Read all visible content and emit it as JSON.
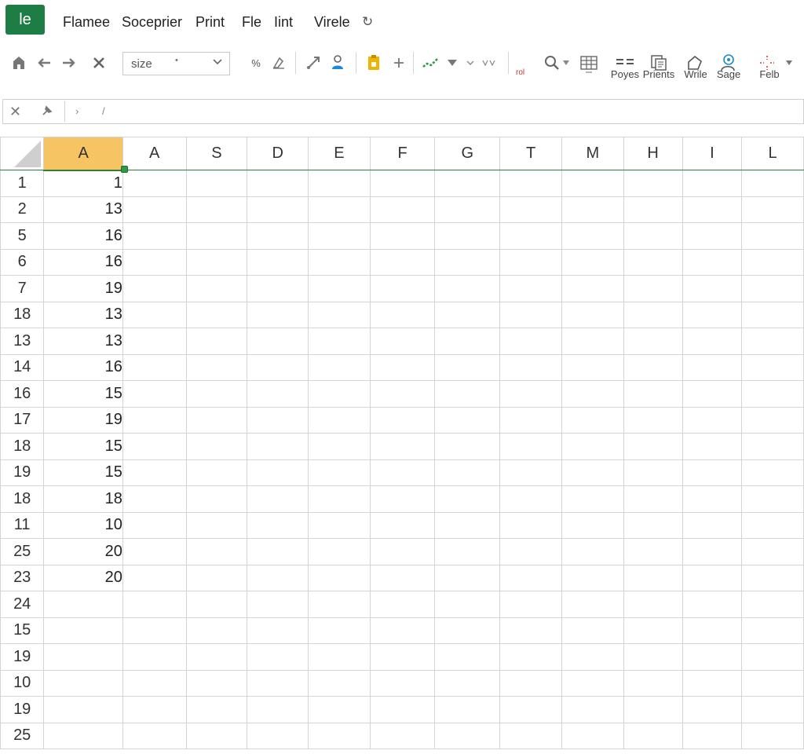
{
  "menubar": {
    "logo_text": "le",
    "items": [
      "Flamee",
      "Soceprier",
      "Print",
      "Fle",
      "Iint",
      "Virele"
    ],
    "extra_glyph": "↻"
  },
  "toolbar": {
    "size_field_value": "size",
    "size_field_dot": "•",
    "percent_label": "%",
    "tiny_red_label": "rol",
    "labeled_buttons": [
      "Poyes",
      "Prients",
      "Wrile",
      "Sage",
      "Felb"
    ],
    "colors": {
      "brand": "#1e7d45",
      "selected_header": "#f7c463",
      "selection_border": "#2e7d32",
      "accent_yellow": "#f0b400",
      "accent_green": "#2e9a44",
      "accent_blue": "#1c8ad6"
    },
    "icons": [
      "home-icon",
      "back-arrow-icon",
      "forward-arrow-icon",
      "close-icon",
      "chevron-down-icon",
      "percent-icon",
      "clear-format-icon",
      "link-icon",
      "user-icon",
      "clipboard-icon",
      "plus-icon",
      "sparkline-icon",
      "triangle-down-icon",
      "search-icon",
      "table-icon",
      "list-icon",
      "copy-icon",
      "home-outline-icon",
      "share-icon",
      "sparkle-icon"
    ]
  },
  "formula_bar": {
    "cancel_glyph": "✕",
    "ticks": [
      "›",
      "/"
    ]
  },
  "sheet": {
    "columns": [
      "A",
      "A",
      "S",
      "D",
      "E",
      "F",
      "G",
      "T",
      "M",
      "H",
      "I",
      "L"
    ],
    "selected_column_index": 0,
    "rows": [
      {
        "label": "1",
        "a": "1"
      },
      {
        "label": "2",
        "a": "13"
      },
      {
        "label": "5",
        "a": "16"
      },
      {
        "label": "6",
        "a": "16"
      },
      {
        "label": "7",
        "a": "19"
      },
      {
        "label": "18",
        "a": "13"
      },
      {
        "label": "13",
        "a": "13"
      },
      {
        "label": "14",
        "a": "16"
      },
      {
        "label": "16",
        "a": "15"
      },
      {
        "label": "17",
        "a": "19"
      },
      {
        "label": "18",
        "a": "15"
      },
      {
        "label": "19",
        "a": "15"
      },
      {
        "label": "18",
        "a": "18"
      },
      {
        "label": "11",
        "a": "10"
      },
      {
        "label": "25",
        "a": "20"
      },
      {
        "label": "23",
        "a": "20"
      },
      {
        "label": "24",
        "a": ""
      },
      {
        "label": "15",
        "a": ""
      },
      {
        "label": "19",
        "a": ""
      },
      {
        "label": "10",
        "a": ""
      },
      {
        "label": "19",
        "a": ""
      },
      {
        "label": "25",
        "a": ""
      }
    ]
  }
}
